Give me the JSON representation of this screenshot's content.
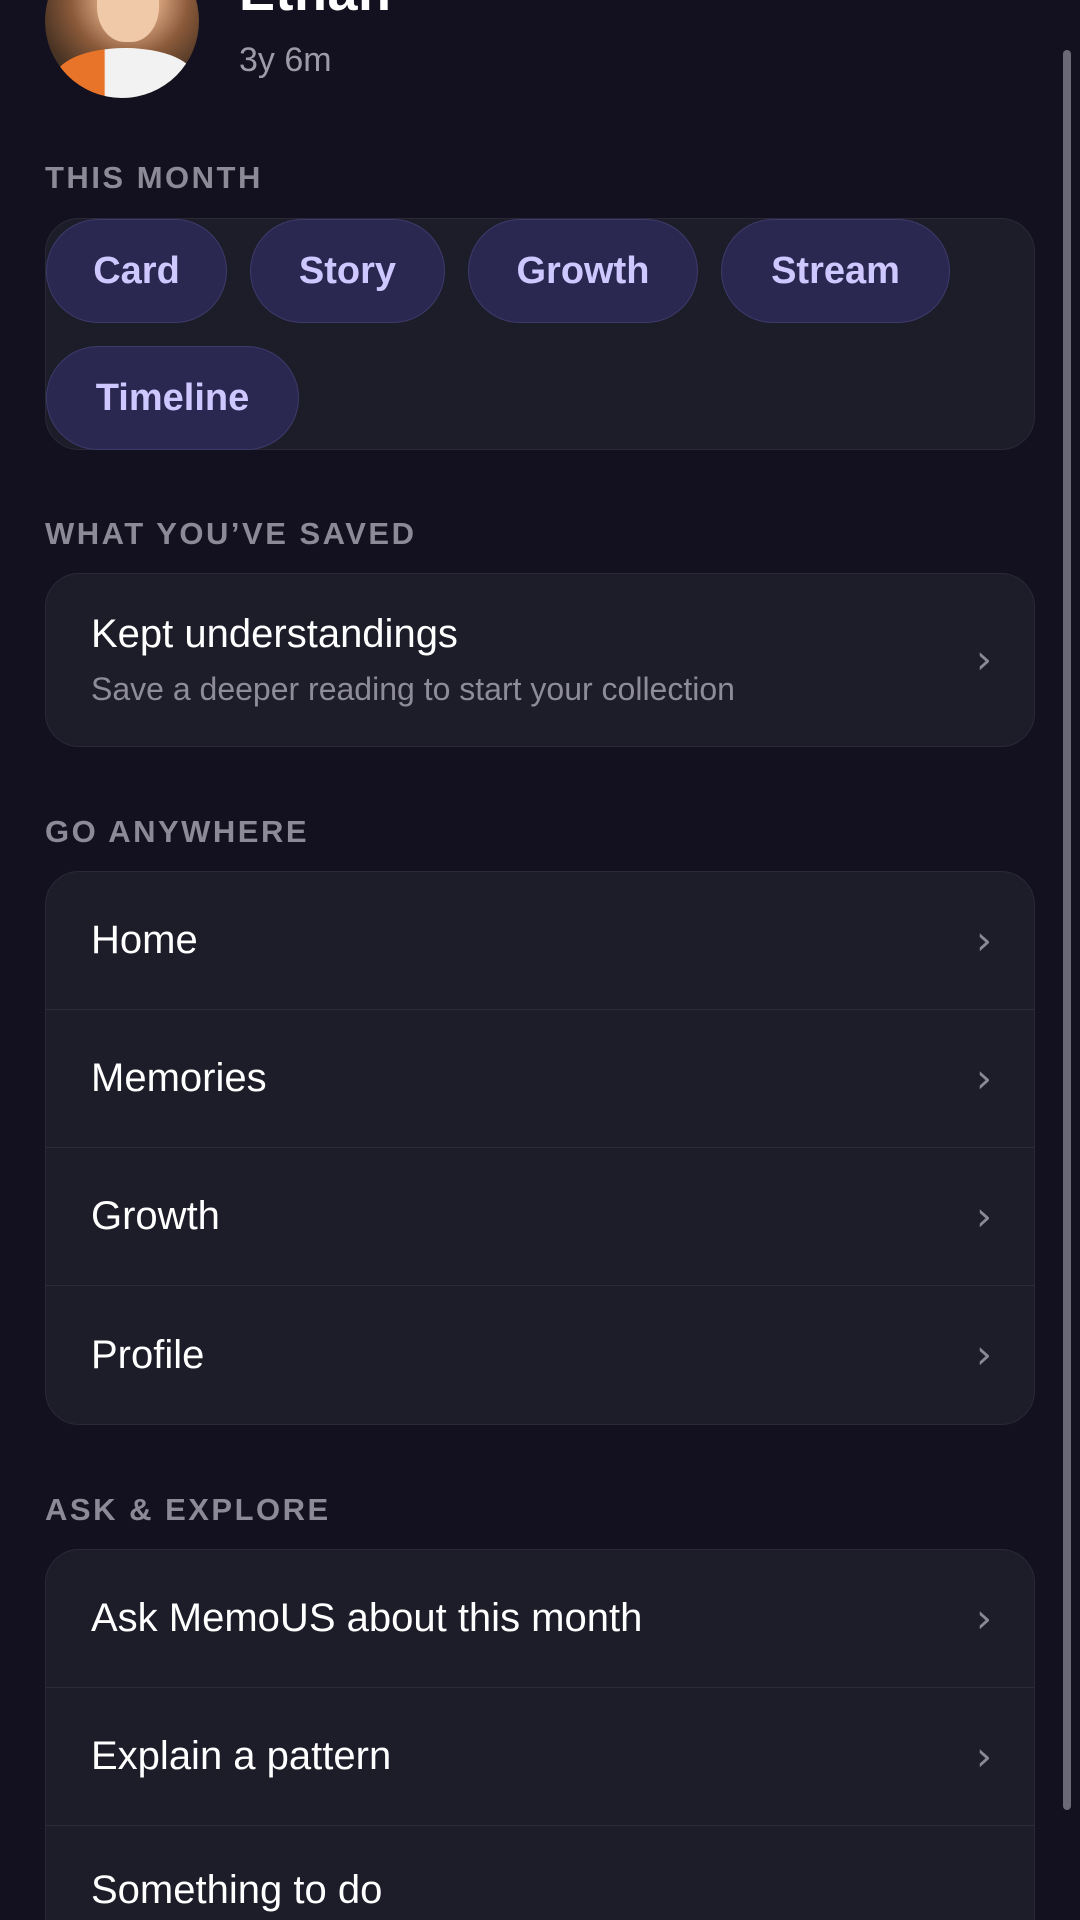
{
  "profile": {
    "name": "Ethan",
    "age": "3y 6m"
  },
  "this_month": {
    "label": "THIS MONTH",
    "chips": [
      "Card",
      "Story",
      "Growth",
      "Stream",
      "Timeline"
    ]
  },
  "saved": {
    "label": "WHAT YOU’VE SAVED",
    "title": "Kept understandings",
    "subtitle": "Save a deeper reading to start your collection"
  },
  "go_anywhere": {
    "label": "GO ANYWHERE",
    "items": [
      "Home",
      "Memories",
      "Growth",
      "Profile"
    ]
  },
  "ask_explore": {
    "label": "ASK & EXPLORE",
    "items": [
      "Ask MemoUS about this month",
      "Explain a pattern",
      "Something to do"
    ]
  },
  "icons": {
    "row_chevron": "chevron-right-icon"
  },
  "colors": {
    "background": "#13111f",
    "card": "#1d1c29",
    "chip": "#2a2850",
    "chip_text": "#cfc7ff"
  }
}
